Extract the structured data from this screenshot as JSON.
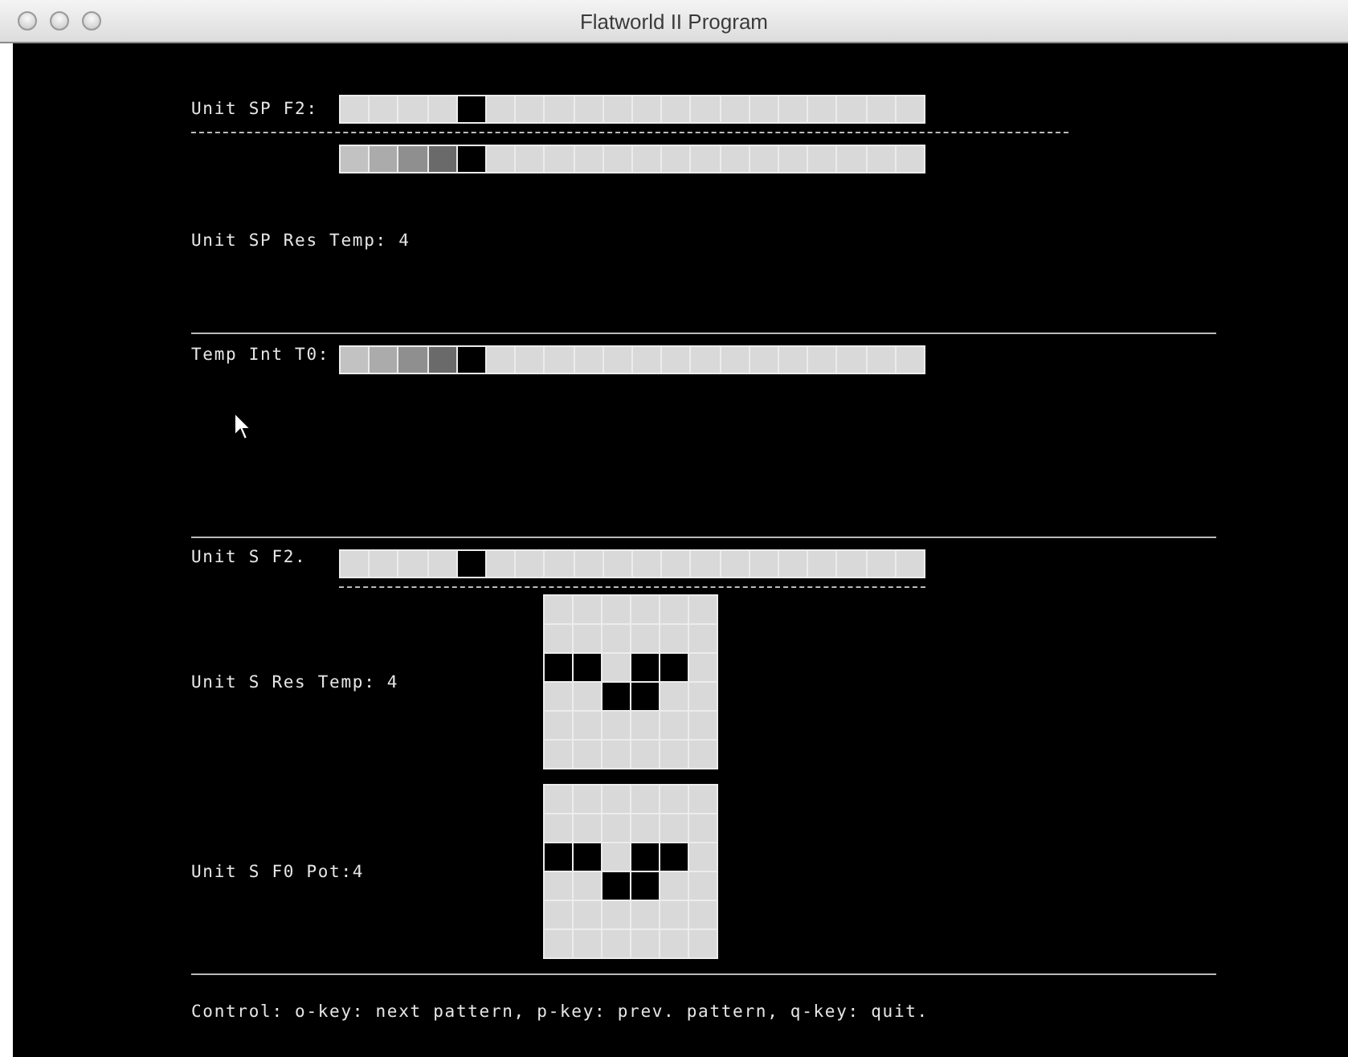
{
  "window": {
    "title": "Flatworld II Program"
  },
  "unit_sp": {
    "f2_label": "Unit SP F2:",
    "f2_bar": {
      "cells": [
        {
          "kind": "blank"
        },
        {
          "kind": "blank"
        },
        {
          "kind": "blank"
        },
        {
          "kind": "blank"
        },
        {
          "kind": "black"
        },
        {
          "kind": "blank"
        },
        {
          "kind": "blank"
        },
        {
          "kind": "blank"
        },
        {
          "kind": "blank"
        },
        {
          "kind": "blank"
        },
        {
          "kind": "blank"
        },
        {
          "kind": "blank"
        },
        {
          "kind": "blank"
        },
        {
          "kind": "blank"
        },
        {
          "kind": "blank"
        },
        {
          "kind": "blank"
        },
        {
          "kind": "blank"
        },
        {
          "kind": "blank"
        },
        {
          "kind": "blank"
        },
        {
          "kind": "blank"
        }
      ]
    },
    "trace_bar": {
      "cells": [
        {
          "kind": "faint"
        },
        {
          "kind": "light"
        },
        {
          "kind": "mid"
        },
        {
          "kind": "dark"
        },
        {
          "kind": "black"
        },
        {
          "kind": "blank"
        },
        {
          "kind": "blank"
        },
        {
          "kind": "blank"
        },
        {
          "kind": "blank"
        },
        {
          "kind": "blank"
        },
        {
          "kind": "blank"
        },
        {
          "kind": "blank"
        },
        {
          "kind": "blank"
        },
        {
          "kind": "blank"
        },
        {
          "kind": "blank"
        },
        {
          "kind": "blank"
        },
        {
          "kind": "blank"
        },
        {
          "kind": "blank"
        },
        {
          "kind": "blank"
        },
        {
          "kind": "blank"
        }
      ]
    },
    "res_temp": "Unit SP Res Temp: 4"
  },
  "temp_int": {
    "label": "Temp Int T0:",
    "bar": {
      "cells": [
        {
          "kind": "faint"
        },
        {
          "kind": "light"
        },
        {
          "kind": "mid"
        },
        {
          "kind": "dark"
        },
        {
          "kind": "black"
        },
        {
          "kind": "blank"
        },
        {
          "kind": "blank"
        },
        {
          "kind": "blank"
        },
        {
          "kind": "blank"
        },
        {
          "kind": "blank"
        },
        {
          "kind": "blank"
        },
        {
          "kind": "blank"
        },
        {
          "kind": "blank"
        },
        {
          "kind": "blank"
        },
        {
          "kind": "blank"
        },
        {
          "kind": "blank"
        },
        {
          "kind": "blank"
        },
        {
          "kind": "blank"
        },
        {
          "kind": "blank"
        },
        {
          "kind": "blank"
        }
      ]
    }
  },
  "unit_s": {
    "f2_label": "Unit S F2.",
    "f2_bar": {
      "cells": [
        {
          "kind": "blank"
        },
        {
          "kind": "blank"
        },
        {
          "kind": "blank"
        },
        {
          "kind": "blank"
        },
        {
          "kind": "black"
        },
        {
          "kind": "blank"
        },
        {
          "kind": "blank"
        },
        {
          "kind": "blank"
        },
        {
          "kind": "blank"
        },
        {
          "kind": "blank"
        },
        {
          "kind": "blank"
        },
        {
          "kind": "blank"
        },
        {
          "kind": "blank"
        },
        {
          "kind": "blank"
        },
        {
          "kind": "blank"
        },
        {
          "kind": "blank"
        },
        {
          "kind": "blank"
        },
        {
          "kind": "blank"
        },
        {
          "kind": "blank"
        },
        {
          "kind": "blank"
        }
      ]
    },
    "res_temp": {
      "label": "Unit S Res Temp: 4",
      "grid": [
        [
          false,
          false,
          false,
          false,
          false,
          false
        ],
        [
          false,
          false,
          false,
          false,
          false,
          false
        ],
        [
          true,
          true,
          false,
          true,
          true,
          false
        ],
        [
          false,
          false,
          true,
          true,
          false,
          false
        ],
        [
          false,
          false,
          false,
          false,
          false,
          false
        ],
        [
          false,
          false,
          false,
          false,
          false,
          false
        ]
      ]
    },
    "f0_pot": {
      "label": "Unit S F0 Pot:4",
      "grid": [
        [
          false,
          false,
          false,
          false,
          false,
          false
        ],
        [
          false,
          false,
          false,
          false,
          false,
          false
        ],
        [
          true,
          true,
          false,
          true,
          true,
          false
        ],
        [
          false,
          false,
          true,
          true,
          false,
          false
        ],
        [
          false,
          false,
          false,
          false,
          false,
          false
        ],
        [
          false,
          false,
          false,
          false,
          false,
          false
        ]
      ]
    }
  },
  "status": "Control: o-key: next pattern, p-key: prev. pattern, q-key: quit."
}
